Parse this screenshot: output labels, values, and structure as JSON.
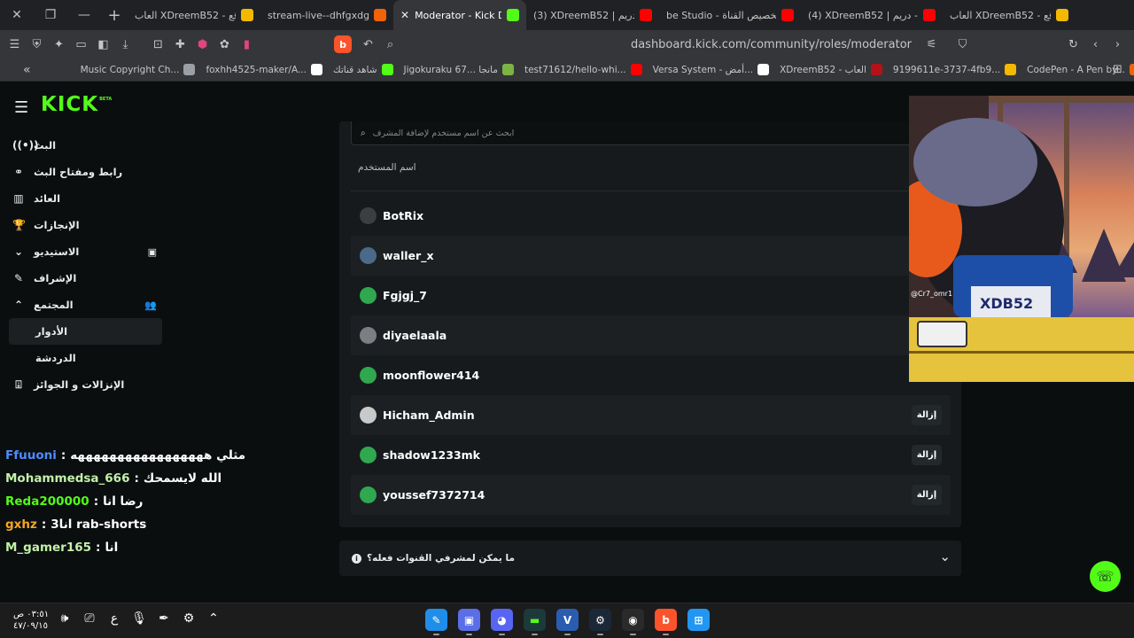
{
  "browser": {
    "tabs": [
      {
        "title": "العاب XDreemB52 - موقع",
        "favicon_color": "#f2b900",
        "active": false
      },
      {
        "title": "stream-live--dhfgxdgd.rep",
        "favicon_color": "#f26207",
        "active": false
      },
      {
        "title": "Moderator - Kick Dash",
        "favicon_color": "#53fc18",
        "active": true
      },
      {
        "title": "(3) XDreemB52 | دريم - You",
        "favicon_color": "#ff0000",
        "active": false
      },
      {
        "title": "be Studio - تخصيص القناة",
        "favicon_color": "#ff0000",
        "active": false
      },
      {
        "title": "(4) XDreemB52 | دريم - You",
        "favicon_color": "#ff0000",
        "active": false
      },
      {
        "title": "العاب XDreemB52 - موقع",
        "favicon_color": "#f2b900",
        "active": false
      }
    ],
    "url": "dashboard.kick.com/community/roles/moderator",
    "bookmarks": [
      {
        "label": "Music Copyright Ch...",
        "favicon_color": "#9aa0a6"
      },
      {
        "label": "foxhh4525-maker/A...",
        "favicon_color": "#ffffff"
      },
      {
        "label": "شاهد قناتك",
        "favicon_color": "#53fc18"
      },
      {
        "label": "Jigokuraku 67... مانجا",
        "favicon_color": "#7cb342"
      },
      {
        "label": "test71612/hello-whi...",
        "favicon_color": "#ff0000"
      },
      {
        "label": "Versa System - أمض...",
        "favicon_color": "#ffffff"
      },
      {
        "label": "XDreemB52 - العاب",
        "favicon_color": "#b31217"
      },
      {
        "label": "9199611e-3737-4fb9...",
        "favicon_color": "#f2b900"
      },
      {
        "label": "CodePen - A Pen by...",
        "favicon_color": "#f26207"
      }
    ]
  },
  "kick": {
    "logo": "KICK",
    "logo_badge": "BETA",
    "nav": [
      {
        "label": "البث",
        "icon": "broadcast-icon"
      },
      {
        "label": "رابط ومفتاح البث",
        "icon": "link-icon"
      },
      {
        "label": "العائد",
        "icon": "chart-icon"
      },
      {
        "label": "الإنجازات",
        "icon": "trophy-icon"
      },
      {
        "label": "الاستيديو",
        "icon": "chevron-down-icon"
      },
      {
        "label": "الإشراف",
        "icon": "wrench-icon"
      },
      {
        "label": "المجتمع",
        "icon": "chevron-up-icon"
      }
    ],
    "community_sub": [
      "الأدوار",
      "الدردشة"
    ],
    "nav_last": {
      "label": "الإنزالات و الجوائز",
      "icon": "gift-icon"
    },
    "search_placeholder": "ابحث عن اسم مستخدم لإضافة المشرف",
    "column_header": "اسم المستخدم",
    "remove_label": "إزالة",
    "moderators": [
      {
        "name": "BotRix",
        "avatar_color": "#3b3f42",
        "removable": false
      },
      {
        "name": "waller_x",
        "avatar_color": "#4a6a8a",
        "removable": false
      },
      {
        "name": "Fgjgj_7",
        "avatar_color": "#2fa84f",
        "removable": false
      },
      {
        "name": "diyaelaala",
        "avatar_color": "#7b7f83",
        "removable": false
      },
      {
        "name": "moonflower414",
        "avatar_color": "#2fa84f",
        "removable": false
      },
      {
        "name": "Hicham_Admin",
        "avatar_color": "#c9c9c9",
        "removable": true
      },
      {
        "name": "shadow1233mk",
        "avatar_color": "#2fa84f",
        "removable": true
      },
      {
        "name": "youssef7372714",
        "avatar_color": "#2fa84f",
        "removable": true
      }
    ],
    "faq": "ما يمكن لمشرفي القنوات فعله؟",
    "accent": "#53fc18"
  },
  "chat": [
    {
      "user": "Ffuuoni",
      "color": "#4e8cff",
      "message": "مثلي هههههههههههههههههه"
    },
    {
      "user": "Mohammedsa_666",
      "color": "#c2f0a8",
      "message": "الله لايسمحك"
    },
    {
      "user": "Reda200000",
      "color": "#53fc18",
      "message": "رضا انا"
    },
    {
      "user": "gxhz",
      "color": "#f5a623",
      "message": "3انا rab-shorts"
    },
    {
      "user": "M_gamer165",
      "color": "#c2f0a8",
      "message": "انا"
    }
  ],
  "overlay": {
    "tag": "@Cr7_omr1",
    "shirt_text": "XDB52"
  },
  "taskbar": {
    "time": "٠٣:٥١ ص",
    "date": "٤٧/٠٩/١٥",
    "lang": "ع"
  }
}
